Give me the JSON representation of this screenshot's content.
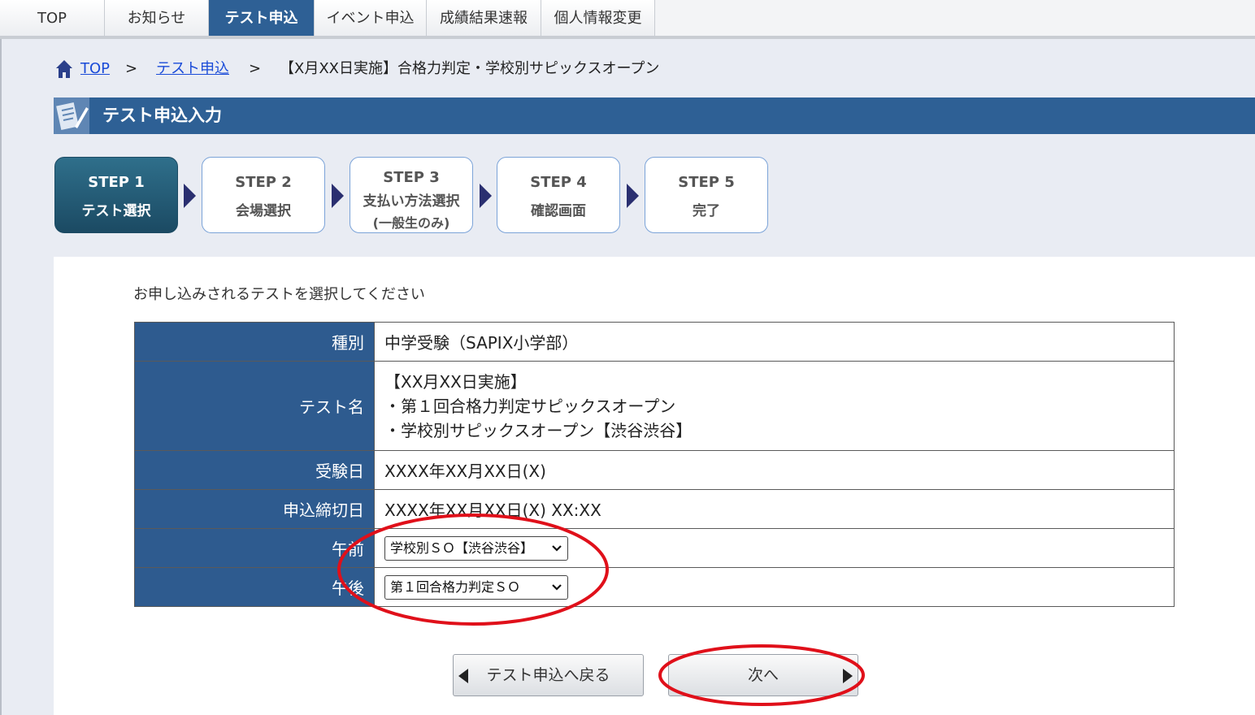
{
  "nav": {
    "tabs": [
      "TOP",
      "お知らせ",
      "テスト申込",
      "イベント申込",
      "成績結果速報",
      "個人情報変更"
    ],
    "active_tab": "テスト申込"
  },
  "breadcrumb": {
    "home": "TOP",
    "sep1": ">",
    "level2": "テスト申込",
    "sep2": ">",
    "current": "【X月XX日実施】合格力判定・学校別サピックスオープン"
  },
  "page_title": "テスト申込入力",
  "steps": [
    {
      "num": "STEP 1",
      "label": "テスト選択"
    },
    {
      "num": "STEP 2",
      "label": "会場選択"
    },
    {
      "num": "STEP 3",
      "label": "支払い方法選択",
      "sub": "(一般生のみ)"
    },
    {
      "num": "STEP 4",
      "label": "確認画面"
    },
    {
      "num": "STEP 5",
      "label": "完了"
    }
  ],
  "instruction": "お申し込みされるテストを選択してください",
  "table": {
    "type_label": "種別",
    "type_value": "中学受験（SAPIX小学部）",
    "testname_label": "テスト名",
    "testname_lines": [
      "【XX月XX日実施】",
      "・第１回合格力判定サピックスオープン",
      "・学校別サピックスオープン【渋谷渋谷】"
    ],
    "date_label": "受験日",
    "date_value": "XXXX年XX月XX日(X)",
    "deadline_label": "申込締切日",
    "deadline_value": "XXXX年XX月XX日(X) XX:XX",
    "am_label": "午前",
    "am_selected": "学校別ＳＯ【渋谷渋谷】",
    "pm_label": "午後",
    "pm_selected": "第１回合格力判定ＳＯ"
  },
  "buttons": {
    "back": "テスト申込へ戻る",
    "next": "次へ"
  },
  "colors": {
    "accent_blue": "#2e6095",
    "header_cell": "#2e5b8f",
    "annotation_red": "#e0101a"
  }
}
